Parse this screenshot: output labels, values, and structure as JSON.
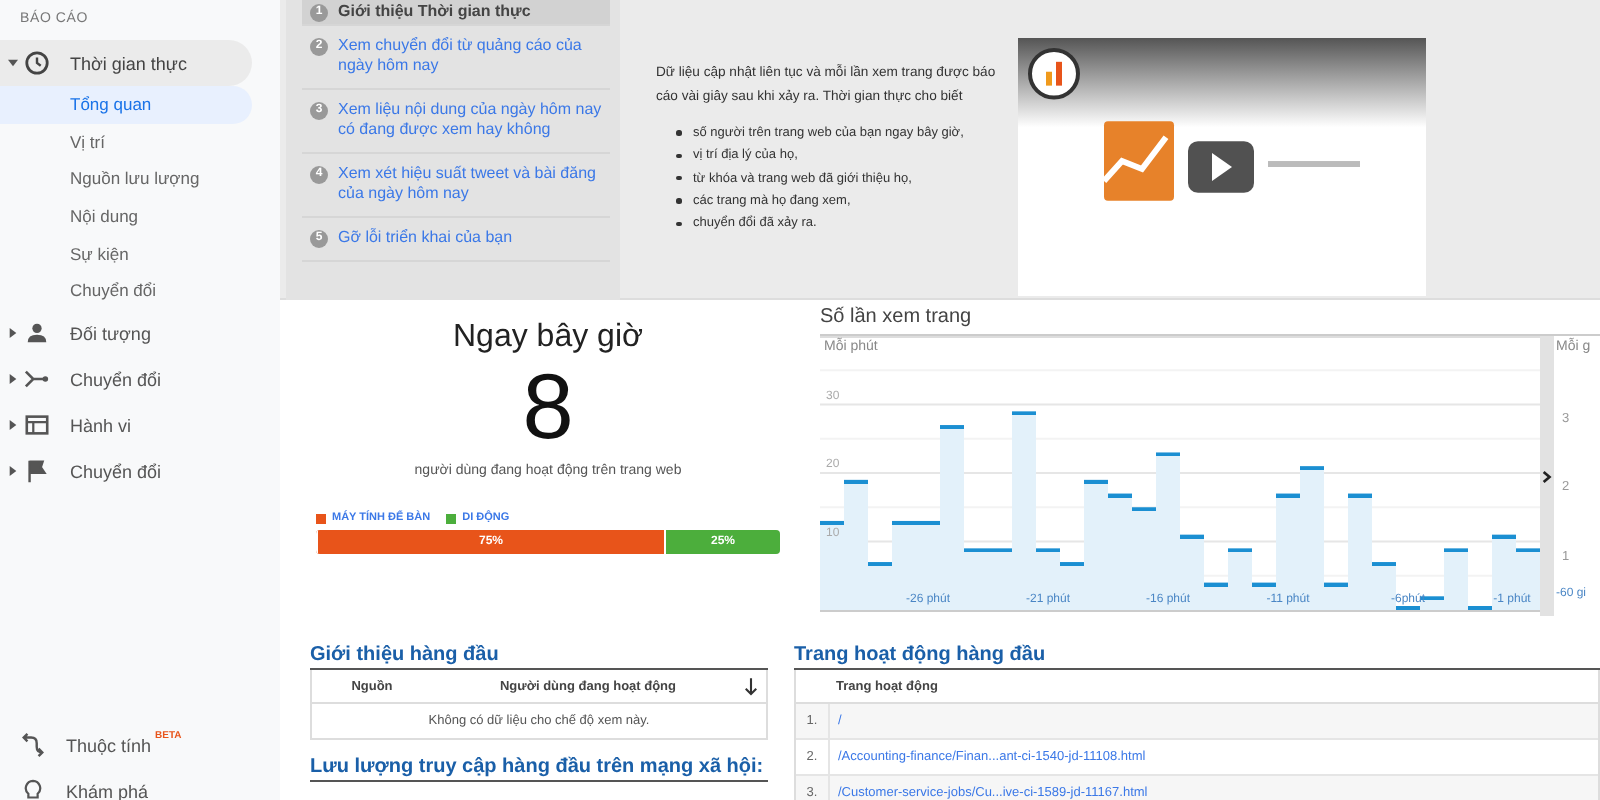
{
  "sidebar": {
    "section_title": "BÁO CÁO",
    "items": [
      {
        "label": "Thời gian thực",
        "expanded": true,
        "children": [
          {
            "label": "Tổng quan",
            "selected": true
          },
          {
            "label": "Vị trí",
            "selected": false
          },
          {
            "label": "Nguồn lưu lượng",
            "selected": false
          },
          {
            "label": "Nội dung",
            "selected": false
          },
          {
            "label": "Sự kiện",
            "selected": false
          },
          {
            "label": "Chuyển đổi",
            "selected": false
          }
        ]
      },
      {
        "label": "Đối tượng",
        "expanded": false
      },
      {
        "label": "Chuyển đổi",
        "expanded": false
      },
      {
        "label": "Hành vi",
        "expanded": false
      },
      {
        "label": "Chuyển đổi",
        "expanded": false
      }
    ],
    "bottom_items": [
      {
        "label": "Thuộc tính",
        "badge": "BETA"
      },
      {
        "label": "Khám phá"
      }
    ]
  },
  "intro": {
    "steps": [
      {
        "number": "1",
        "label": "Giới thiệu Thời gian thực",
        "selected": true
      },
      {
        "number": "2",
        "label": "Xem chuyển đổi từ quảng cáo của ngày hôm nay",
        "selected": false
      },
      {
        "number": "3",
        "label": "Xem liệu nội dung của ngày hôm nay có đang được xem hay không",
        "selected": false
      },
      {
        "number": "4",
        "label": "Xem xét hiệu suất tweet và bài đăng của ngày hôm nay",
        "selected": false
      },
      {
        "number": "5",
        "label": "Gỡ lỗi triển khai của bạn",
        "selected": false
      }
    ],
    "description": "Dữ liệu cập nhật liên tục và mỗi lần xem trang được báo cáo vài giây sau khi xảy ra. Thời gian thực cho biết",
    "bullets": [
      "số người trên trang web của bạn ngay bây giờ,",
      "vị trí địa lý của họ,",
      "từ khóa và trang web đã giới thiệu họ,",
      "các trang mà họ đang xem,",
      "chuyển đổi đã xảy ra."
    ],
    "video": {
      "kind": "picture"
    }
  },
  "now": {
    "title": "Ngay bây giờ",
    "count": "8",
    "caption": "người dùng đang hoạt động trên trang web",
    "devices": [
      {
        "label": "MÁY TÍNH ĐỂ BÀN",
        "share": "75%",
        "level": 0.75,
        "color": "#e8541a"
      },
      {
        "label": "DI ĐỘNG",
        "share": "25%",
        "level": 0.25,
        "color": "#4cae3c"
      }
    ]
  },
  "pageviews": {
    "title": "Số lần xem trang",
    "per_minute": {
      "label": "Mỗi phút",
      "chart_data": {
        "type": "bar",
        "x": [
          -30,
          -29,
          -28,
          -27,
          -26,
          -25,
          -24,
          -23,
          -22,
          -21,
          -20,
          -19,
          -18,
          -17,
          -16,
          -15,
          -14,
          -13,
          -12,
          -11,
          -10,
          -9,
          -8,
          -7,
          -6,
          -5,
          -4,
          -3,
          -2,
          -1
        ],
        "values": [
          13,
          19,
          7,
          13,
          13,
          27,
          9,
          9,
          29,
          9,
          7,
          19,
          17,
          15,
          23,
          11,
          4,
          9,
          4,
          17,
          21,
          4,
          17,
          7,
          0,
          2,
          9,
          0,
          11,
          9
        ],
        "xlim": [
          -30.5,
          -0.5
        ],
        "ylim": [
          0,
          40
        ],
        "yticks": [
          10,
          20,
          30
        ],
        "grid": true,
        "xticks": [
          {
            "value": -26,
            "label": "-26 phút"
          },
          {
            "value": -21,
            "label": "-21 phút"
          },
          {
            "value": -16,
            "label": "-16 phút"
          },
          {
            "value": -11,
            "label": "-11 phút"
          },
          {
            "value": -6,
            "label": "-6phút"
          },
          {
            "value": -1,
            "label": "-1 phút"
          }
        ]
      }
    },
    "per_hour": {
      "label": "Mỗi g",
      "tick_labels": [
        "3",
        "2",
        "1"
      ],
      "x_label": "-60 gi"
    }
  },
  "top_referrals": {
    "title": "Giới thiệu hàng đầu",
    "columns": [
      "Nguồn",
      "Người dùng đang hoạt động"
    ],
    "empty_message": "Không có dữ liệu cho chế độ xem này."
  },
  "social_traffic": {
    "title": "Lưu lượng truy cập hàng đầu trên mạng xã hội:"
  },
  "top_pages": {
    "title": "Trang hoạt động hàng đầu",
    "columns": [
      "Trang hoạt động"
    ],
    "rows": [
      {
        "index": "1.",
        "page": "/"
      },
      {
        "index": "2.",
        "page": "/Accounting-finance/Finan...ant-ci-1540-jd-11108.html"
      },
      {
        "index": "3.",
        "page": "/Customer-service-jobs/Cu...ive-ci-1589-jd-11167.html"
      }
    ]
  }
}
